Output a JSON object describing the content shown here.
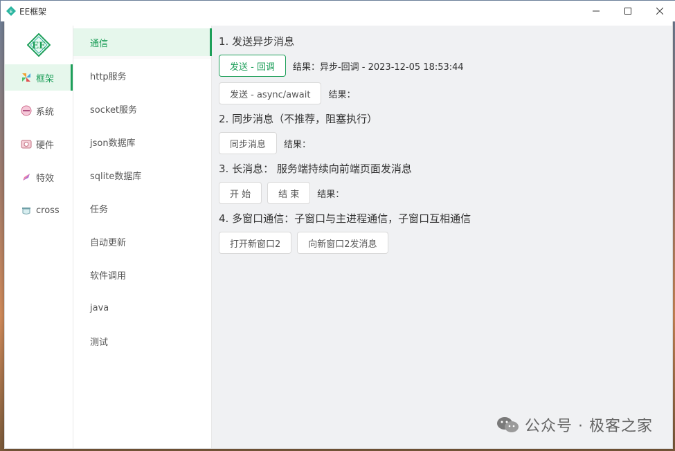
{
  "window": {
    "title": "EE框架",
    "controls": [
      "minimize",
      "maximize",
      "close"
    ]
  },
  "logo": "EE",
  "rail": {
    "items": [
      {
        "label": "框架",
        "icon": "pinwheel-icon",
        "active": true
      },
      {
        "label": "系统",
        "icon": "system-icon",
        "active": false
      },
      {
        "label": "硬件",
        "icon": "camera-icon",
        "active": false
      },
      {
        "label": "特效",
        "icon": "rocket-icon",
        "active": false
      },
      {
        "label": "cross",
        "icon": "pot-icon",
        "active": false
      }
    ]
  },
  "subnav": {
    "items": [
      {
        "label": "通信",
        "active": true
      },
      {
        "label": "http服务"
      },
      {
        "label": "socket服务"
      },
      {
        "label": "json数据库"
      },
      {
        "label": "sqlite数据库"
      },
      {
        "label": "任务"
      },
      {
        "label": "自动更新"
      },
      {
        "label": "软件调用"
      },
      {
        "label": "java"
      },
      {
        "label": "测试"
      }
    ]
  },
  "main": {
    "sec1_title": "1. 发送异步消息",
    "btn_async_callback": "发送 - 回调",
    "result_async_callback": "结果：异步-回调 - 2023-12-05 18:53:44",
    "btn_async_await": "发送 - async/await",
    "result_async_await": "结果：",
    "sec2_title": "2. 同步消息（不推荐，阻塞执行）",
    "btn_sync": "同步消息",
    "result_sync": "结果：",
    "sec3_title": "3. 长消息： 服务端持续向前端页面发消息",
    "btn_start": "开 始",
    "btn_end": "结 束",
    "result_long": "结果：",
    "sec4_title": "4. 多窗口通信：子窗口与主进程通信，子窗口互相通信",
    "btn_open_window": "打开新窗口2",
    "btn_send_window": "向新窗口2发消息"
  },
  "watermark": "公众号 · 极客之家",
  "colors": {
    "accent": "#1e9f5a",
    "active_bg": "#e6f7ec",
    "content_bg": "#f0f1f3"
  }
}
